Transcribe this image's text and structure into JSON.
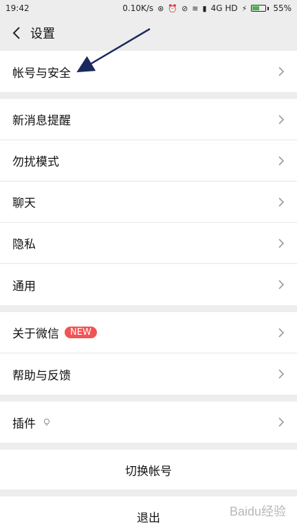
{
  "statusbar": {
    "time": "19:42",
    "net_speed": "0.10K/s",
    "network": "4G HD",
    "battery": "55%",
    "battery_level": 0.55
  },
  "navbar": {
    "title": "设置"
  },
  "groups": [
    {
      "rows": [
        {
          "label": "帐号与安全"
        }
      ]
    },
    {
      "rows": [
        {
          "label": "新消息提醒"
        },
        {
          "label": "勿扰模式"
        },
        {
          "label": "聊天"
        },
        {
          "label": "隐私"
        },
        {
          "label": "通用"
        }
      ]
    },
    {
      "rows": [
        {
          "label": "关于微信",
          "badge": "NEW"
        },
        {
          "label": "帮助与反馈"
        }
      ]
    },
    {
      "rows": [
        {
          "label": "插件"
        }
      ]
    }
  ],
  "switch_account": "切换帐号",
  "logout": "退出",
  "watermark": "Baidu经验",
  "colors": {
    "badge": "#f25353",
    "arrow": "#1b2a5e"
  }
}
